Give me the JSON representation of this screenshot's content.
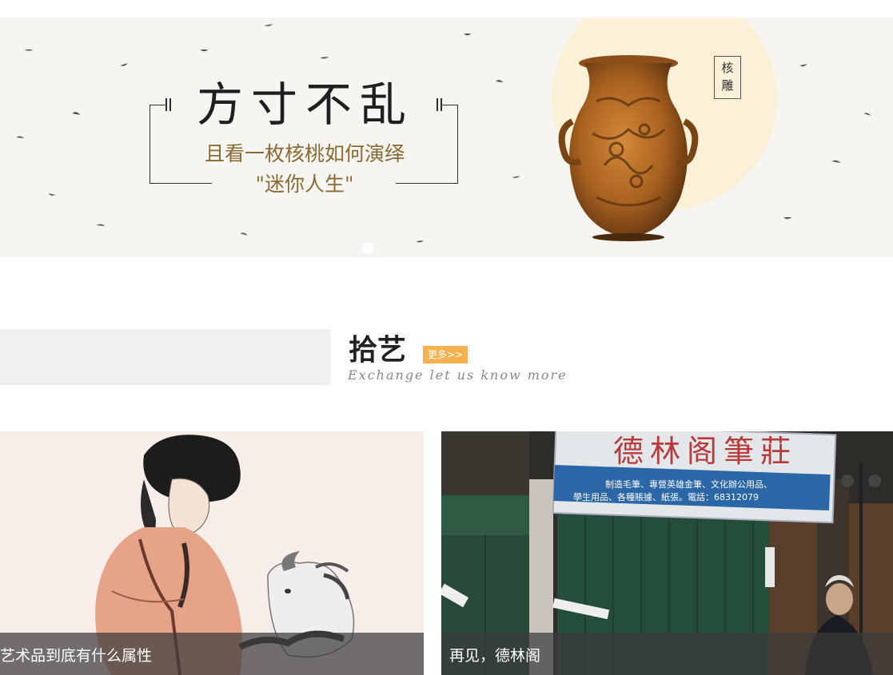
{
  "banner": {
    "title": "方寸不乱",
    "subtitle_line1": "且看一枚核桃如何演绎",
    "subtitle_line2": "\"迷你人生\"",
    "label_char1": "核",
    "label_char2": "雕",
    "colors": {
      "title": "#1f1f1f",
      "subtitle": "#8a6a32",
      "circle": "#fbf0d8"
    }
  },
  "section": {
    "title": "拾艺",
    "more_label": "更多>>",
    "subtitle": "Exchange let us know more",
    "colors": {
      "more_bg": "#f6b24f"
    }
  },
  "cards": [
    {
      "caption": "艺术品到底有什么属性"
    },
    {
      "caption": "再见，德林阁",
      "sign_main": "德林阁筆莊",
      "sign_line1": "制造毛筆、專營英雄金筆、文化辦公用品、",
      "sign_line2": "學生用品、各種賬據、紙張。電話：68312079"
    }
  ]
}
